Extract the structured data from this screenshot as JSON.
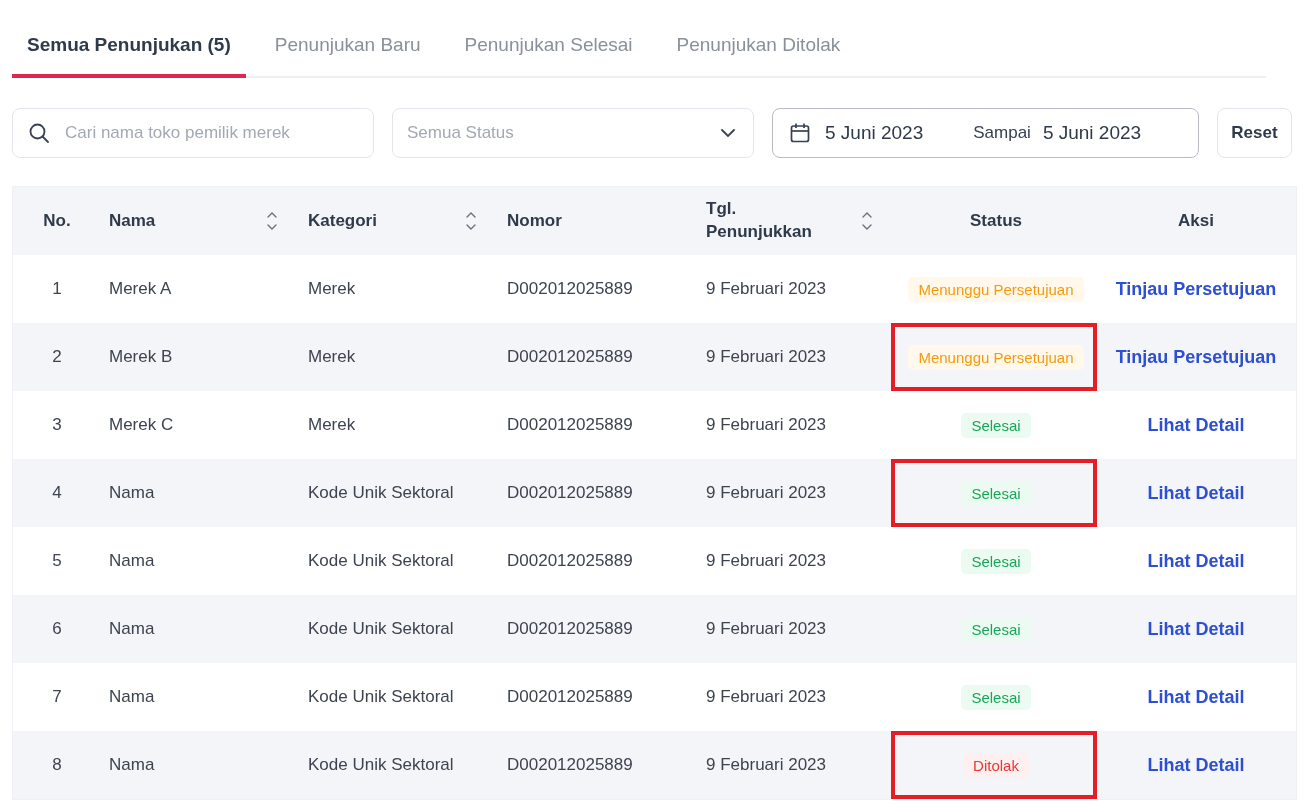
{
  "tabs": [
    {
      "label": "Semua Penunjukan (5)",
      "selected": true
    },
    {
      "label": "Penunjukan Baru",
      "selected": false
    },
    {
      "label": "Penunjukan Selesai",
      "selected": false
    },
    {
      "label": "Penunjukan Ditolak",
      "selected": false
    }
  ],
  "filters": {
    "search": {
      "placeholder": "Cari nama toko pemilik merek"
    },
    "status": {
      "placeholder": "Semua Status"
    },
    "date_from": "5 Juni 2023",
    "date_separator": "Sampai",
    "date_to": "5 Juni 2023",
    "reset": "Reset"
  },
  "table": {
    "columns": [
      {
        "label": "No.",
        "sortable": false
      },
      {
        "label": "Nama",
        "sortable": true
      },
      {
        "label": "Kategori",
        "sortable": true
      },
      {
        "label": "Nomor",
        "sortable": false
      },
      {
        "label": "Tgl. Penunjukkan",
        "sortable": true
      },
      {
        "label": "Status",
        "sortable": false
      },
      {
        "label": "Aksi",
        "sortable": false
      }
    ],
    "rows": [
      {
        "no": "1",
        "name": "Merek A",
        "category": "Merek",
        "number": "D002012025889",
        "date": "9 Februari 2023",
        "status": {
          "label": "Menunggu Persetujuan",
          "kind": "pending"
        },
        "highlighted": false,
        "action": "Tinjau Persetujuan"
      },
      {
        "no": "2",
        "name": "Merek B",
        "category": "Merek",
        "number": "D002012025889",
        "date": "9 Februari 2023",
        "status": {
          "label": "Menunggu Persetujuan",
          "kind": "pending"
        },
        "highlighted": true,
        "action": "Tinjau Persetujuan"
      },
      {
        "no": "3",
        "name": "Merek C",
        "category": "Merek",
        "number": "D002012025889",
        "date": "9 Februari 2023",
        "status": {
          "label": "Selesai",
          "kind": "done"
        },
        "highlighted": false,
        "action": "Lihat Detail"
      },
      {
        "no": "4",
        "name": "Nama",
        "category": "Kode Unik Sektoral",
        "number": "D002012025889",
        "date": "9 Februari 2023",
        "status": {
          "label": "Selesai",
          "kind": "done"
        },
        "highlighted": true,
        "action": "Lihat Detail"
      },
      {
        "no": "5",
        "name": "Nama",
        "category": "Kode Unik Sektoral",
        "number": "D002012025889",
        "date": "9 Februari 2023",
        "status": {
          "label": "Selesai",
          "kind": "done"
        },
        "highlighted": false,
        "action": "Lihat Detail"
      },
      {
        "no": "6",
        "name": "Nama",
        "category": "Kode Unik Sektoral",
        "number": "D002012025889",
        "date": "9 Februari 2023",
        "status": {
          "label": "Selesai",
          "kind": "done"
        },
        "highlighted": false,
        "action": "Lihat Detail"
      },
      {
        "no": "7",
        "name": "Nama",
        "category": "Kode Unik Sektoral",
        "number": "D002012025889",
        "date": "9 Februari 2023",
        "status": {
          "label": "Selesai",
          "kind": "done"
        },
        "highlighted": false,
        "action": "Lihat Detail"
      },
      {
        "no": "8",
        "name": "Nama",
        "category": "Kode Unik Sektoral",
        "number": "D002012025889",
        "date": "9 Februari 2023",
        "status": {
          "label": "Ditolak",
          "kind": "rejected"
        },
        "highlighted": true,
        "action": "Lihat Detail"
      }
    ]
  }
}
